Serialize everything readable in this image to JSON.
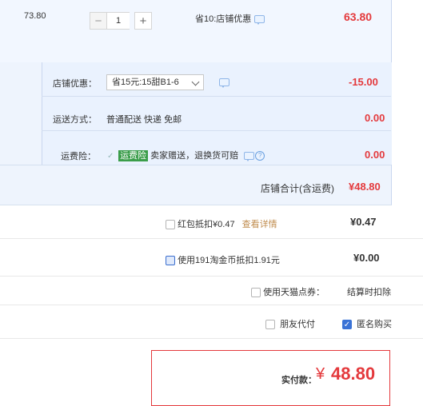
{
  "item": {
    "unit_price": "73.80",
    "qty_minus": "−",
    "qty_value": "1",
    "qty_plus": "+",
    "promo": "省10:店铺优惠",
    "subtotal": "63.80"
  },
  "shop": {
    "discount_label": "店铺优惠：",
    "discount_selected": "省15元:15甜B1-6",
    "discount_amount": "-15.00",
    "shipping_label": "运送方式：",
    "shipping_value": "普通配送 快递 免邮",
    "shipping_amount": "0.00",
    "insurance_label": "运费险：",
    "insurance_checkmark": "✓",
    "insurance_badge": "运费险",
    "insurance_text": "卖家赠送，退换货可赔",
    "insurance_amount": "0.00",
    "total_label": "店铺合计(含运费)",
    "total_value": "¥48.80"
  },
  "options": {
    "redpacket_label": "红包抵扣¥0.47",
    "redpacket_link": "查看详情",
    "redpacket_value": "¥0.47",
    "coin_label": "使用191淘金币抵扣1.91元",
    "coin_value": "¥0.00",
    "tmall_points_label": "使用天猫点券：",
    "tmall_points_note": "结算时扣除",
    "friend_pay_label": "朋友代付",
    "anonymous_label": "匿名购买",
    "checkmark": "✓"
  },
  "payment": {
    "label": "实付款：",
    "currency": "¥",
    "amount": "48.80"
  },
  "colors": {
    "price_red": "#e4393c",
    "panel_blue": "#eef4fd",
    "badge_green": "#3a9d4a",
    "link_orange": "#c08c4e"
  },
  "icons": {
    "chat": "chat-bubble-icon",
    "help": "question-circle-icon",
    "dropdown": "chevron-down-icon",
    "check": "checkmark-icon"
  }
}
